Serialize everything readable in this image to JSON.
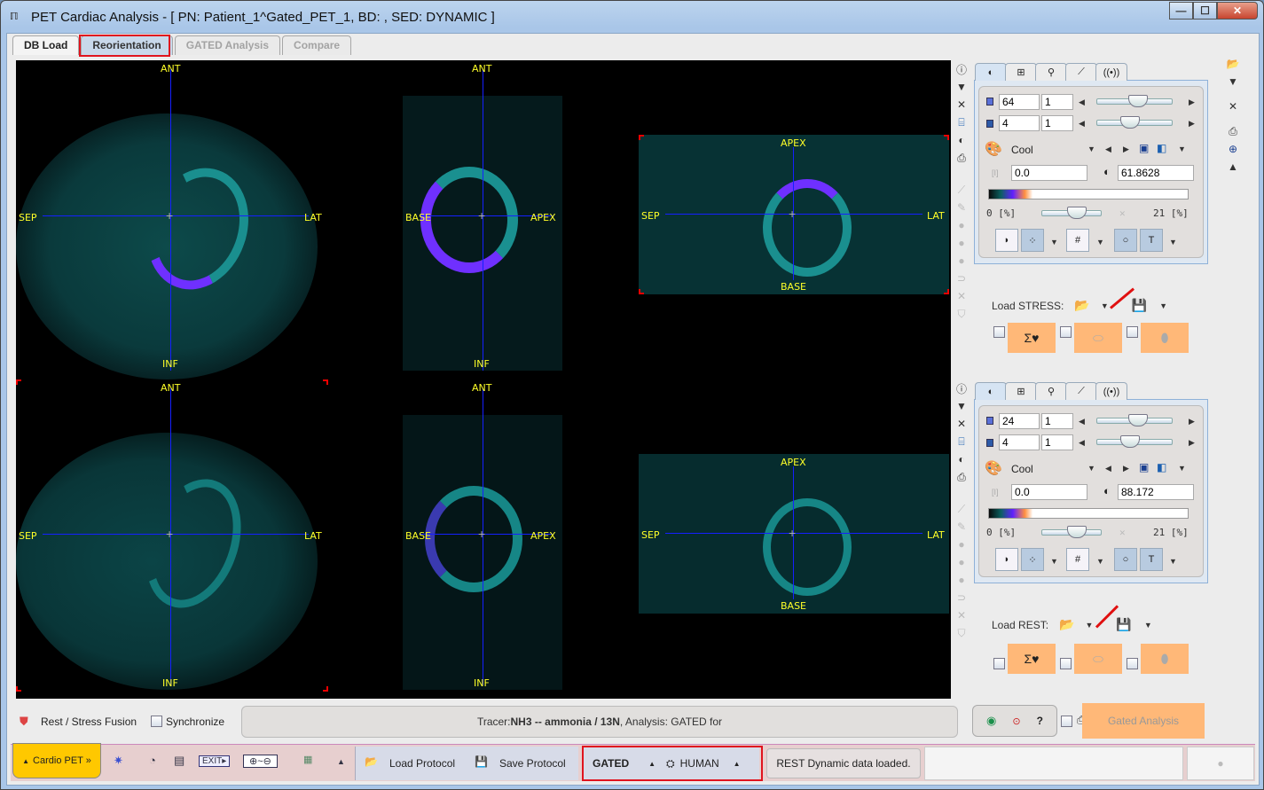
{
  "window": {
    "title": "PET Cardiac Analysis - [ PN: Patient_1^Gated_PET_1, BD: , SED: DYNAMIC ]",
    "app_icon": "pmod-icon",
    "controls": {
      "minimize": "—",
      "maximize": "☐",
      "close": "✕"
    }
  },
  "tabs": [
    {
      "label": "DB Load",
      "state": "enabled"
    },
    {
      "label": "Reorientation",
      "state": "selected",
      "highlighted": true
    },
    {
      "label": "GATED Analysis",
      "state": "disabled"
    },
    {
      "label": "Compare",
      "state": "disabled"
    }
  ],
  "viewer": {
    "rows": [
      {
        "name": "stress",
        "views": [
          {
            "labels": {
              "top": "ANT",
              "bottom": "INF",
              "left": "SEP",
              "right": "LAT"
            }
          },
          {
            "labels": {
              "top": "ANT",
              "bottom": "INF",
              "left": "BASE",
              "right": "APEX"
            }
          },
          {
            "labels": {
              "top": "APEX",
              "bottom": "BASE",
              "left": "SEP",
              "right": "LAT"
            }
          }
        ]
      },
      {
        "name": "rest",
        "views": [
          {
            "labels": {
              "top": "ANT",
              "bottom": "INF",
              "left": "SEP",
              "right": "LAT"
            }
          },
          {
            "labels": {
              "top": "ANT",
              "bottom": "INF",
              "left": "BASE",
              "right": "APEX"
            }
          },
          {
            "labels": {
              "top": "APEX",
              "bottom": "BASE",
              "left": "SEP",
              "right": "LAT"
            }
          }
        ]
      }
    ],
    "crosshair_color": "#1520ff",
    "label_color": "#ffff28"
  },
  "panels": [
    {
      "name": "stress",
      "slice": "64",
      "slice_step": "1",
      "frame": "4",
      "frame_step": "1",
      "colormap": "Cool",
      "lower": "0.0",
      "upper": "61.8628",
      "range_min": "0",
      "range_max": "21",
      "range_unit": "[%]",
      "load_label": "Load STRESS:"
    },
    {
      "name": "rest",
      "slice": "24",
      "slice_step": "1",
      "frame": "4",
      "frame_step": "1",
      "colormap": "Cool",
      "lower": "0.0",
      "upper": "88.172",
      "range_min": "0",
      "range_max": "21",
      "range_unit": "[%]",
      "load_label": "Load REST:"
    }
  ],
  "panel_tabs": [
    "contrast-icon",
    "layout-icon",
    "reorient-icon",
    "curve-icon",
    "signal-icon"
  ],
  "bottom": {
    "fusion_label": "Rest / Stress Fusion",
    "synchronize_label": "Synchronize",
    "synchronize_checked": false,
    "status_prefix": "Tracer: ",
    "tracer": "NH3 -- ammonia / 13N",
    "analysis_text": ",  Analysis: GATED for",
    "gated_analysis_label": "Gated Analysis"
  },
  "toolbar": {
    "cardio_label": "Cardio PET »",
    "load_protocol": "Load Protocol",
    "save_protocol": "Save Protocol",
    "mode": "GATED",
    "species": "HUMAN",
    "message": "REST Dynamic data loaded."
  },
  "icons": {
    "up": "▲",
    "down": "▼",
    "left": "◀",
    "right": "▶",
    "help": "?"
  }
}
